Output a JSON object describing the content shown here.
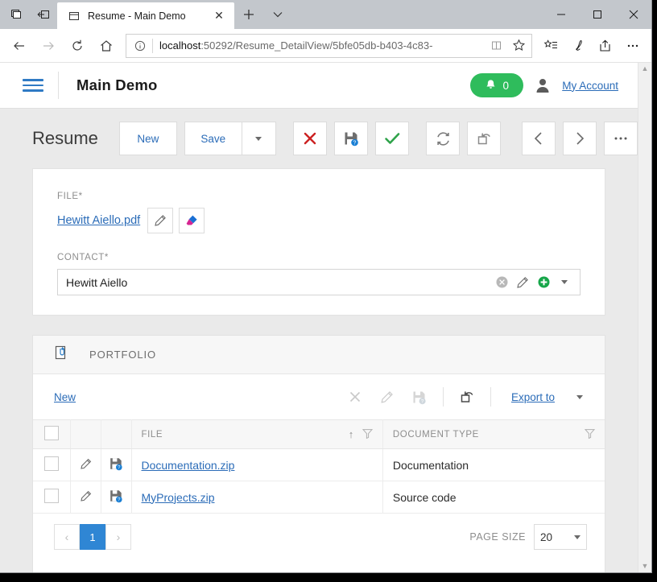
{
  "browser": {
    "tab": {
      "title": "Resume - Main Demo",
      "favicon": "window-icon",
      "close": "✕"
    },
    "new_tab_label": "+",
    "tab_menu_label": "⌄",
    "system_buttons": [
      "tab-preview-icon",
      "set-tabs-aside-icon"
    ],
    "window_controls": {
      "minimize": "–",
      "maximize": "☐",
      "close": "✕"
    },
    "nav": {
      "back": "←",
      "forward": "→",
      "refresh": "↻",
      "home": "⌂"
    },
    "address": {
      "info_icon": "info-icon",
      "url_bold": "localhost",
      "url_rest": ":50292/Resume_DetailView/5bfe05db-b403-4c83-",
      "reading_view_icon": "reading-view-icon",
      "favorite_icon": "star-icon"
    },
    "toolbar_right": [
      "favorites-icon",
      "notes-icon",
      "share-icon",
      "more-icon"
    ]
  },
  "app_header": {
    "menu_icon": "hamburger-icon",
    "title": "Main Demo",
    "notification_count": "0",
    "account_label": "My Account"
  },
  "detail": {
    "title": "Resume",
    "new_label": "New",
    "save_label": "Save",
    "save_dropdown": "chevron-down-icon",
    "actions": [
      {
        "name": "delete",
        "icon": "red-x-icon"
      },
      {
        "name": "save-and-new",
        "icon": "save-question-icon"
      },
      {
        "name": "save-and-close",
        "icon": "green-check-icon"
      },
      {
        "name": "refresh",
        "icon": "refresh-icon"
      },
      {
        "name": "reset",
        "icon": "reset-window-icon"
      },
      {
        "name": "previous-object",
        "icon": "chevron-left-icon"
      },
      {
        "name": "next-object",
        "icon": "chevron-right-icon"
      },
      {
        "name": "more-actions",
        "icon": "ellipsis-icon"
      }
    ]
  },
  "form": {
    "file_label": "FILE*",
    "file_name": "Hewitt Aiello.pdf",
    "file_edit_icon": "pencil-icon",
    "file_clear_icon": "eraser-icon",
    "contact_label": "CONTACT*",
    "contact_value": "Hewitt Aiello",
    "contact_clear_icon": "clear-circle-icon",
    "contact_edit_icon": "pencil-icon",
    "contact_add_icon": "plus-circle-icon",
    "contact_dropdown_icon": "chevron-down-icon"
  },
  "portfolio": {
    "section_icon": "attachment-icon",
    "section_title": "PORTFOLIO",
    "toolbar": {
      "new_label": "New",
      "delete_icon": "x-icon",
      "edit_icon": "pencil-icon",
      "save_icon": "save-question-icon",
      "reset_icon": "reset-window-icon",
      "export_label": "Export to",
      "export_dropdown_icon": "chevron-down-icon"
    },
    "grid": {
      "columns": [
        {
          "key": "checkbox",
          "label": ""
        },
        {
          "key": "edit",
          "label": ""
        },
        {
          "key": "save",
          "label": ""
        },
        {
          "key": "file",
          "label": "FILE",
          "sort": "↑",
          "filter_icon": "filter-icon"
        },
        {
          "key": "doctype",
          "label": "DOCUMENT TYPE",
          "filter_icon": "filter-icon"
        }
      ],
      "rows": [
        {
          "file": "Documentation.zip",
          "doctype": "Documentation"
        },
        {
          "file": "MyProjects.zip",
          "doctype": "Source code"
        }
      ]
    },
    "pager": {
      "prev": "‹",
      "current_page": "1",
      "next": "›",
      "page_size_label": "PAGE SIZE",
      "page_size_value": "20"
    }
  },
  "colors": {
    "accent_blue": "#2b6cb8",
    "pager_blue": "#2f86d4",
    "green": "#2fbc5c",
    "red": "#cc2222"
  }
}
